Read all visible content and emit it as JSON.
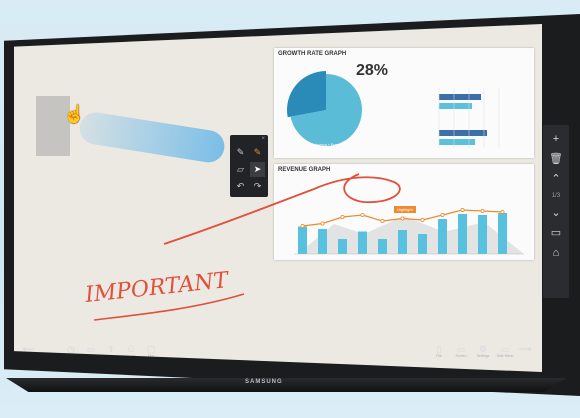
{
  "brand": "SAMSUNG",
  "side_panel": {
    "items": [
      {
        "icon": "plus-icon",
        "glyph": "+"
      },
      {
        "icon": "trash-icon",
        "glyph": "🗑"
      },
      {
        "icon": "chevron-up-icon",
        "glyph": "⌃"
      },
      {
        "icon": "chevron-down-icon",
        "glyph": "⌄"
      },
      {
        "icon": "monitor-icon",
        "glyph": "▭"
      },
      {
        "icon": "home-icon",
        "glyph": "⌂"
      }
    ],
    "page_indicator": "1/3"
  },
  "palette": {
    "tools": [
      {
        "icon": "pen-black-icon",
        "glyph": "✎",
        "active": false
      },
      {
        "icon": "pen-orange-icon",
        "glyph": "✎",
        "active": false
      },
      {
        "icon": "eraser-icon",
        "glyph": "▱",
        "active": false
      },
      {
        "icon": "select-icon",
        "glyph": "➤",
        "active": true
      },
      {
        "icon": "undo-icon",
        "glyph": "↶",
        "active": false
      },
      {
        "icon": "redo-icon",
        "glyph": "↷",
        "active": false
      }
    ],
    "close": "×"
  },
  "growth_card": {
    "title": "GROWTH RATE GRAPH",
    "percent": "28%",
    "pie_label": "America + Europe"
  },
  "revenue_card": {
    "title": "REVENUE GRAPH",
    "highlight_tag": "Highlight"
  },
  "annotation": "IMPORTANT",
  "chart_data": [
    {
      "type": "pie",
      "title": "GROWTH RATE GRAPH",
      "values": [
        72,
        28
      ],
      "labels": [
        "America + Europe",
        ""
      ],
      "colors": [
        "#5bbcd8",
        "#2a8ab8"
      ]
    },
    {
      "type": "bar",
      "orientation": "horizontal",
      "series": [
        {
          "values": [
            70,
            80
          ]
        },
        {
          "values": [
            55,
            60
          ]
        }
      ],
      "colors": [
        "#3d6ea8",
        "#5bc0dc"
      ]
    },
    {
      "type": "bar",
      "title": "REVENUE GRAPH",
      "values": [
        55,
        50,
        30,
        45,
        30,
        48,
        40,
        70,
        80,
        78,
        82
      ],
      "line_values": [
        40,
        45,
        58,
        62,
        50,
        55,
        52,
        62,
        72,
        70,
        68
      ],
      "colors": [
        "#58c2de",
        "#f08a30"
      ]
    }
  ],
  "toolbar": {
    "left_items": [
      {
        "icon": "back-arrow-icon",
        "glyph": "⟵",
        "label": ""
      },
      {
        "icon": "clock-icon",
        "glyph": "◷",
        "label": "History"
      },
      {
        "icon": "folder-icon",
        "glyph": "▭",
        "label": "Contents"
      },
      {
        "icon": "share-icon",
        "glyph": "⇪",
        "label": "Share"
      },
      {
        "icon": "user-icon",
        "glyph": "⚇",
        "label": "Users"
      },
      {
        "icon": "screen-icon",
        "glyph": "▢",
        "label": "Tips"
      }
    ],
    "right_items": [
      {
        "icon": "file-icon",
        "glyph": "▯",
        "label": "File"
      },
      {
        "icon": "display-icon",
        "glyph": "▭",
        "label": "Screen"
      },
      {
        "icon": "gear-icon",
        "glyph": "⚙",
        "label": "Settings"
      },
      {
        "icon": "menu-icon",
        "glyph": "▭",
        "label": "Side Menu"
      },
      {
        "icon": "forward-arrow-icon",
        "glyph": "⟶",
        "label": ""
      }
    ]
  }
}
